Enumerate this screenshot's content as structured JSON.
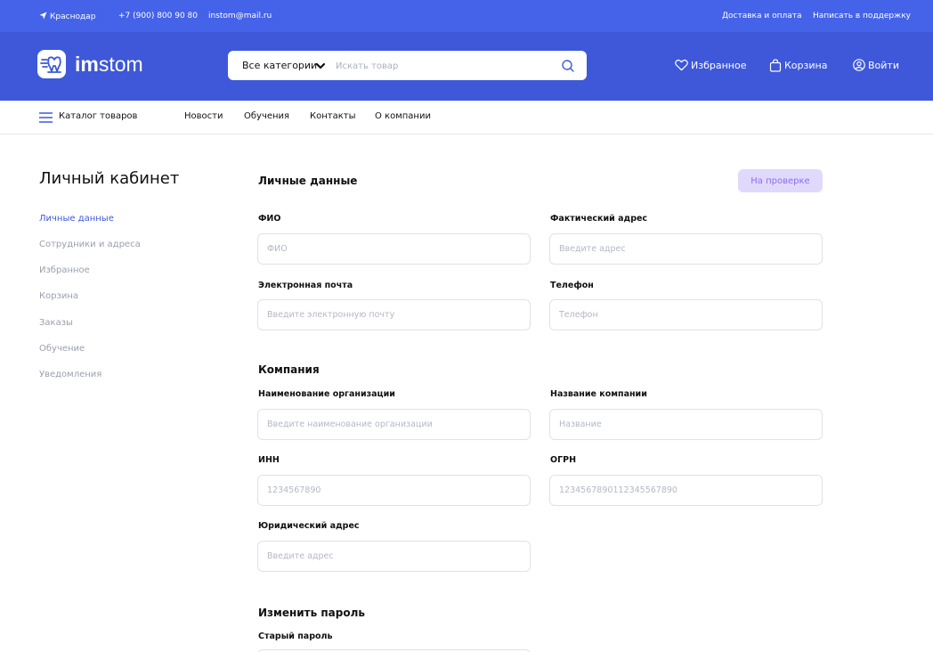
{
  "topbar": {
    "city": "Краснодар",
    "phone": "+7 (900) 800 90 80",
    "email": "instom@mail.ru",
    "delivery": "Доставка и оплата",
    "support": "Написать в поддержку"
  },
  "header": {
    "logo_bold": "im",
    "logo_rest": "stom",
    "search": {
      "category": "Все категории",
      "placeholder": "Искать товар"
    },
    "favorites": "Избранное",
    "cart": "Корзина",
    "login": "Войти"
  },
  "nav": {
    "catalog": "Каталог товаров",
    "items": [
      "Новости",
      "Обучения",
      "Контакты",
      "О компании"
    ]
  },
  "sidebar": {
    "title": "Личный кабинет",
    "items": [
      "Личные данные",
      "Сотрудники и адреса",
      "Избранное",
      "Корзина",
      "Заказы",
      "Обучение",
      "Уведомления"
    ]
  },
  "personal": {
    "title": "Личные данные",
    "status": "На проверке",
    "fio_label": "ФИО",
    "fio_placeholder": "ФИО",
    "address_label": "Фактический адрес",
    "address_placeholder": "Введите адрес",
    "email_label": "Электронная почта",
    "email_placeholder": "Введите электронную почту",
    "phone_label": "Телефон",
    "phone_placeholder": "Телефон"
  },
  "company": {
    "title": "Компания",
    "org_label": "Наименование организации",
    "org_placeholder": "Введите наименование организации",
    "name_label": "Название компании",
    "name_placeholder": "Название",
    "inn_label": "ИНН",
    "inn_placeholder": "1234567890",
    "ogrn_label": "ОГРН",
    "ogrn_placeholder": "1234567890112345567890",
    "legal_label": "Юридический адрес",
    "legal_placeholder": "Введите адрес"
  },
  "password": {
    "title": "Изменить пароль",
    "old_label": "Старый пароль"
  }
}
